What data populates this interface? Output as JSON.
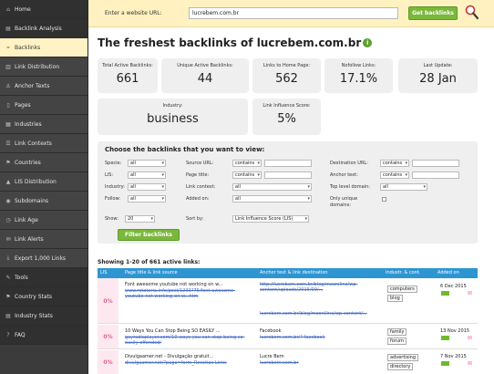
{
  "sidebar": {
    "items": [
      {
        "label": "Home",
        "icon": "home-icon",
        "glyph": "⌂"
      },
      {
        "label": "Backlink Analysis",
        "icon": "chart-icon",
        "glyph": "▤"
      },
      {
        "label": "Backlinks",
        "icon": "link-icon",
        "glyph": "⚭"
      },
      {
        "label": "Link Distribution",
        "icon": "distribution-icon",
        "glyph": "▥"
      },
      {
        "label": "Anchor Texts",
        "icon": "anchor-icon",
        "glyph": "⚓"
      },
      {
        "label": "Pages",
        "icon": "pages-icon",
        "glyph": "▯"
      },
      {
        "label": "Industries",
        "icon": "industries-icon",
        "glyph": "▦"
      },
      {
        "label": "Link Contexts",
        "icon": "contexts-icon",
        "glyph": "☰"
      },
      {
        "label": "Countries",
        "icon": "countries-icon",
        "glyph": "⚑"
      },
      {
        "label": "LIS Distribution",
        "icon": "lis-icon",
        "glyph": "▲"
      },
      {
        "label": "Subdomains",
        "icon": "subdomains-icon",
        "glyph": "◉"
      },
      {
        "label": "Link Age",
        "icon": "clock-icon",
        "glyph": "◷"
      },
      {
        "label": "Link Alerts",
        "icon": "alert-icon",
        "glyph": "✉"
      },
      {
        "label": "Export 1,000 Links",
        "icon": "export-icon",
        "glyph": "⤓"
      },
      {
        "label": "Tools",
        "icon": "tools-icon",
        "glyph": "✎"
      },
      {
        "label": "Country Stats",
        "icon": "flag-icon",
        "glyph": "⚑"
      },
      {
        "label": "Industry Stats",
        "icon": "stats-icon",
        "glyph": "▤"
      },
      {
        "label": "FAQ",
        "icon": "question-icon",
        "glyph": "?"
      }
    ]
  },
  "topbar": {
    "url_label": "Enter a website URL:",
    "url_value": "lucrebem.com.br",
    "button": "Get backlinks"
  },
  "page": {
    "title": "The freshest backlinks of lucrebem.com.br",
    "info_glyph": "i"
  },
  "stats": [
    {
      "label": "Total Active Backlinks:",
      "value": "661"
    },
    {
      "label": "Unique Active Backlinks:",
      "value": "44"
    },
    {
      "label": "Links to Home Page:",
      "value": "562"
    },
    {
      "label": "Nofollow Links:",
      "value": "17.1%"
    },
    {
      "label": "Last Update:",
      "value": "28 Jan"
    },
    {
      "label": "Industry:",
      "value": "business"
    },
    {
      "label": "Link Influence Score:",
      "value": "5%"
    }
  ],
  "filters": {
    "title": "Choose the backlinks that you want to view:",
    "specie_label": "Specie:",
    "specie_value": "all",
    "lis_label": "LIS:",
    "lis_value": "all",
    "industry_label": "Industry:",
    "industry_value": "all",
    "follow_label": "Follow:",
    "follow_value": "all",
    "show_label": "Show:",
    "show_value": "20",
    "source_url_label": "Source URL:",
    "source_url_op": "contains",
    "page_title_label": "Page title:",
    "page_title_op": "contains",
    "link_context_label": "Link context:",
    "link_context_value": "all",
    "added_on_label": "Added on:",
    "added_on_value": "all",
    "sort_label": "Sort by:",
    "sort_value": "Link Influence Score (LIS)",
    "dest_url_label": "Destination URL:",
    "dest_url_op": "contains",
    "anchor_label": "Anchor text:",
    "anchor_op": "contains",
    "tld_label": "Top level domain:",
    "tld_value": "all",
    "unique_label": "Only unique domains:",
    "button": "Filter backlinks"
  },
  "table": {
    "showing": "Showing 1-20 of 661 active links:",
    "headers": [
      "LIS",
      "Page title & link source",
      "Anchor text & link destination",
      "Industr. & cont.",
      "Added on"
    ],
    "rows": [
      {
        "lis": "0%",
        "title": "Font awesome youtube not working on w...",
        "source": "www.rotatoria.info/post/1233?75/font-awesome-youtube-not-working-on-w...htm",
        "anchor": "http://lucrebem.com.br/blog/mooniline/wp-content/uploads/2015/09/...",
        "dest": "lucrebem.com.br/blog/mooniline/wp-content/...",
        "tags": [
          "computers",
          "blog"
        ],
        "date": "6 Dec 2015"
      },
      {
        "lis": "0%",
        "title": "10 Ways You Can Stop Being SO EASILY ...",
        "source": "gayradiaplayer.com/10-ways-you-can-stop-being-so-easily-offended/",
        "anchor": "Facebook",
        "dest": "lucrebem.com.br/?-facebook",
        "tags": [
          "family",
          "forum"
        ],
        "date": "13 Nov 2015"
      },
      {
        "lis": "0%",
        "title": "Divulgaamer.net - Divulgação gratuit...",
        "source": "divulgaamer.net/?page=form_Receitas-Links",
        "anchor": "Lucre Bem",
        "dest": "lucrebem.com.br",
        "tags": [
          "advertising",
          "directory"
        ],
        "date": "7 Nov 2015"
      }
    ]
  },
  "colors": {
    "accent": "#7ab83b",
    "sidebar": "#3b3b3b",
    "table_header": "#2e95d3",
    "lis_text": "#e0608b"
  }
}
